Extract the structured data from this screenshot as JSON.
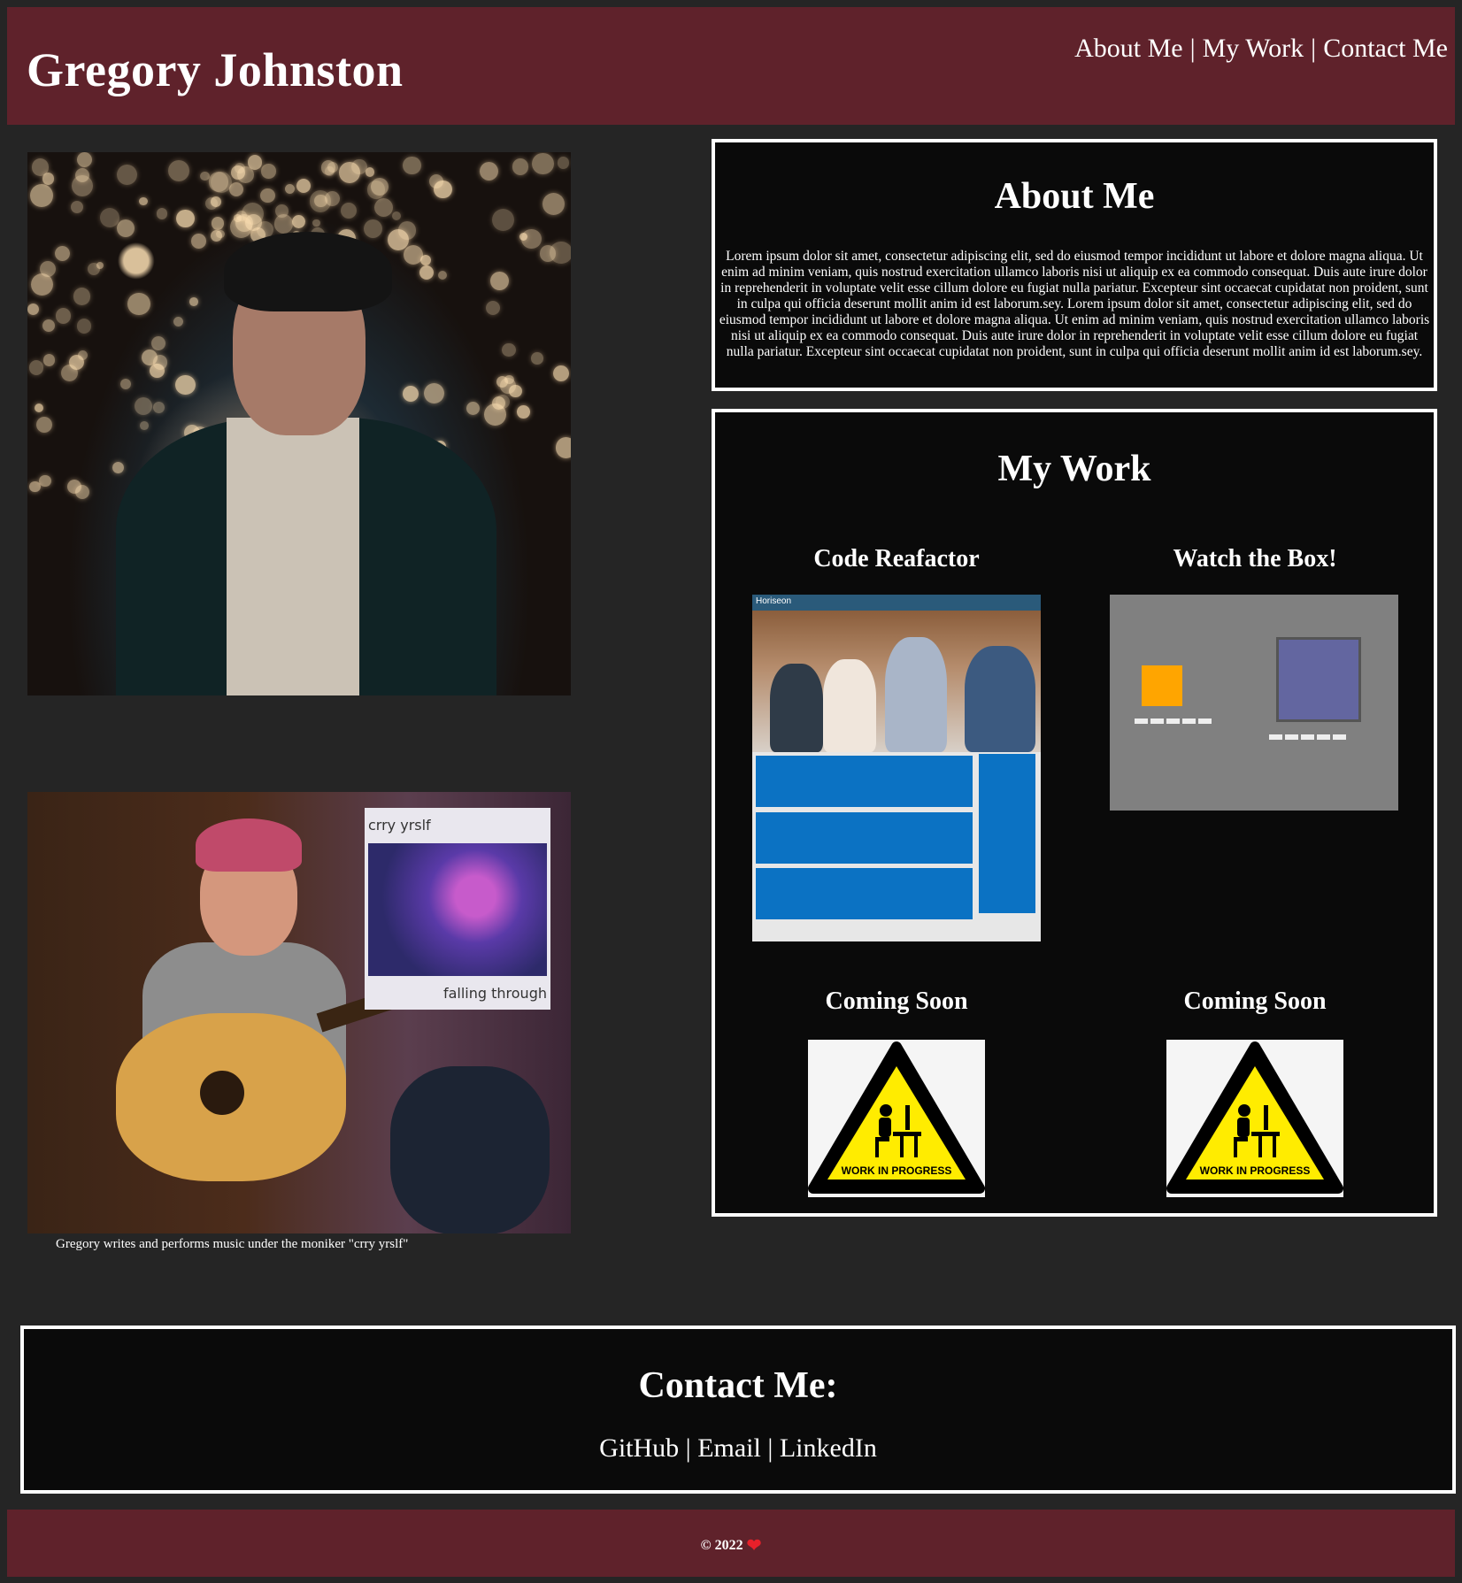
{
  "header": {
    "title": "Gregory Johnston",
    "nav": [
      {
        "label": "About Me"
      },
      {
        "label": "My Work"
      },
      {
        "label": "Contact Me"
      }
    ],
    "separator": "|"
  },
  "photos": {
    "caption": "Gregory writes and performs music under the moniker \"crry yrslf\"",
    "album_title": "crry yrslf",
    "album_subtitle": "falling through"
  },
  "about": {
    "heading": "About Me",
    "body": "Lorem ipsum dolor sit amet, consectetur adipiscing elit, sed do eiusmod tempor incididunt ut labore et dolore magna aliqua. Ut enim ad minim veniam, quis nostrud exercitation ullamco laboris nisi ut aliquip ex ea commodo consequat. Duis aute irure dolor in reprehenderit in voluptate velit esse cillum dolore eu fugiat nulla pariatur. Excepteur sint occaecat cupidatat non proident, sunt in culpa qui officia deserunt mollit anim id est laborum.sey. Lorem ipsum dolor sit amet, consectetur adipiscing elit, sed do eiusmod tempor incididunt ut labore et dolore magna aliqua. Ut enim ad minim veniam, quis nostrud exercitation ullamco laboris nisi ut aliquip ex ea commodo consequat. Duis aute irure dolor in reprehenderit in voluptate velit esse cillum dolore eu fugiat nulla pariatur. Excepteur sint occaecat cupidatat non proident, sunt in culpa qui officia deserunt mollit anim id est laborum.sey."
  },
  "work": {
    "heading": "My Work",
    "projects": [
      {
        "title": "Code Reafactor",
        "thumbnail_brand": "Horiseon"
      },
      {
        "title": "Watch the Box!"
      },
      {
        "title": "Coming Soon",
        "badge": "WORK IN PROGRESS"
      },
      {
        "title": "Coming Soon",
        "badge": "WORK IN PROGRESS"
      }
    ]
  },
  "contact": {
    "heading": "Contact Me:",
    "links": [
      {
        "label": "GitHub"
      },
      {
        "label": "Email"
      },
      {
        "label": "LinkedIn"
      }
    ],
    "separator": "|"
  },
  "footer": {
    "copyright": "© 2022",
    "heart_icon": "heart-icon"
  },
  "colors": {
    "header_bg": "#5f222b",
    "page_bg": "#252525",
    "panel_bg": "#0a0a0a",
    "panel_border": "#ffffff"
  }
}
